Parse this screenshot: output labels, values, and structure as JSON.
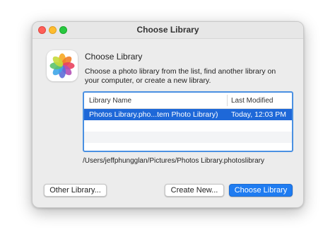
{
  "window": {
    "title": "Choose Library"
  },
  "dialog": {
    "heading": "Choose Library",
    "description": "Choose a photo library from the list, find another library on your computer, or create a new library.",
    "app_icon": "photos-app-icon"
  },
  "table": {
    "columns": [
      "Library Name",
      "Last Modified"
    ],
    "rows": [
      {
        "name": "Photos Library.pho...tem Photo Library)",
        "modified": "Today, 12:03 PM",
        "selected": true
      }
    ]
  },
  "path": "/Users/jeffphungglan/Pictures/Photos Library.photoslibrary",
  "buttons": {
    "other": "Other Library...",
    "create": "Create New...",
    "choose": "Choose Library"
  },
  "colors": {
    "accent": "#1f7cf1",
    "selection": "#1e68d8",
    "close": "#ff5f57",
    "minimize": "#febc2e",
    "maximize": "#28c840"
  }
}
